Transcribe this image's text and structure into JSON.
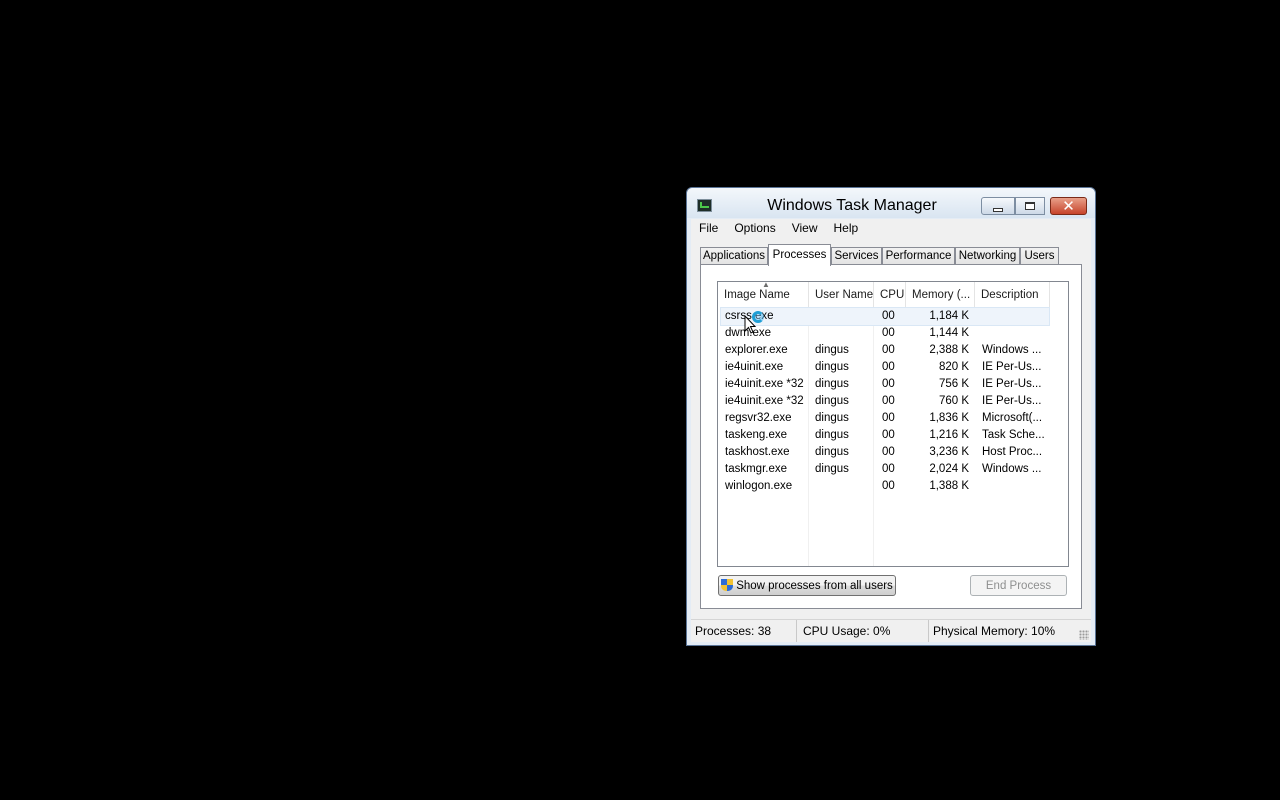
{
  "window": {
    "title": "Windows Task Manager"
  },
  "menu": [
    "File",
    "Options",
    "View",
    "Help"
  ],
  "tabs": [
    "Applications",
    "Processes",
    "Services",
    "Performance",
    "Networking",
    "Users"
  ],
  "active_tab": "Processes",
  "columns": [
    "Image Name",
    "User Name",
    "CPU",
    "Memory (...",
    "Description"
  ],
  "processes": [
    {
      "name": "csrss.exe",
      "user": "",
      "cpu": "00",
      "mem": "1,184 K",
      "desc": ""
    },
    {
      "name": "dwm.exe",
      "user": "",
      "cpu": "00",
      "mem": "1,144 K",
      "desc": ""
    },
    {
      "name": "explorer.exe",
      "user": "dingus",
      "cpu": "00",
      "mem": "2,388 K",
      "desc": "Windows ..."
    },
    {
      "name": "ie4uinit.exe",
      "user": "dingus",
      "cpu": "00",
      "mem": "820 K",
      "desc": "IE Per-Us..."
    },
    {
      "name": "ie4uinit.exe *32",
      "user": "dingus",
      "cpu": "00",
      "mem": "756 K",
      "desc": "IE Per-Us..."
    },
    {
      "name": "ie4uinit.exe *32",
      "user": "dingus",
      "cpu": "00",
      "mem": "760 K",
      "desc": "IE Per-Us..."
    },
    {
      "name": "regsvr32.exe",
      "user": "dingus",
      "cpu": "00",
      "mem": "1,836 K",
      "desc": "Microsoft(..."
    },
    {
      "name": "taskeng.exe",
      "user": "dingus",
      "cpu": "00",
      "mem": "1,216 K",
      "desc": "Task Sche..."
    },
    {
      "name": "taskhost.exe",
      "user": "dingus",
      "cpu": "00",
      "mem": "3,236 K",
      "desc": "Host Proc..."
    },
    {
      "name": "taskmgr.exe",
      "user": "dingus",
      "cpu": "00",
      "mem": "2,024 K",
      "desc": "Windows ..."
    },
    {
      "name": "winlogon.exe",
      "user": "",
      "cpu": "00",
      "mem": "1,388 K",
      "desc": ""
    }
  ],
  "buttons": {
    "show_all": "Show processes from all users",
    "end_process": "End Process"
  },
  "status": {
    "processes": "Processes: 38",
    "cpu": "CPU Usage: 0%",
    "memory": "Physical Memory: 10%"
  },
  "icons": {
    "app": "task-manager-icon",
    "minimize": "minimize-icon",
    "maximize": "maximize-icon",
    "close": "close-icon",
    "shield": "uac-shield-icon"
  }
}
